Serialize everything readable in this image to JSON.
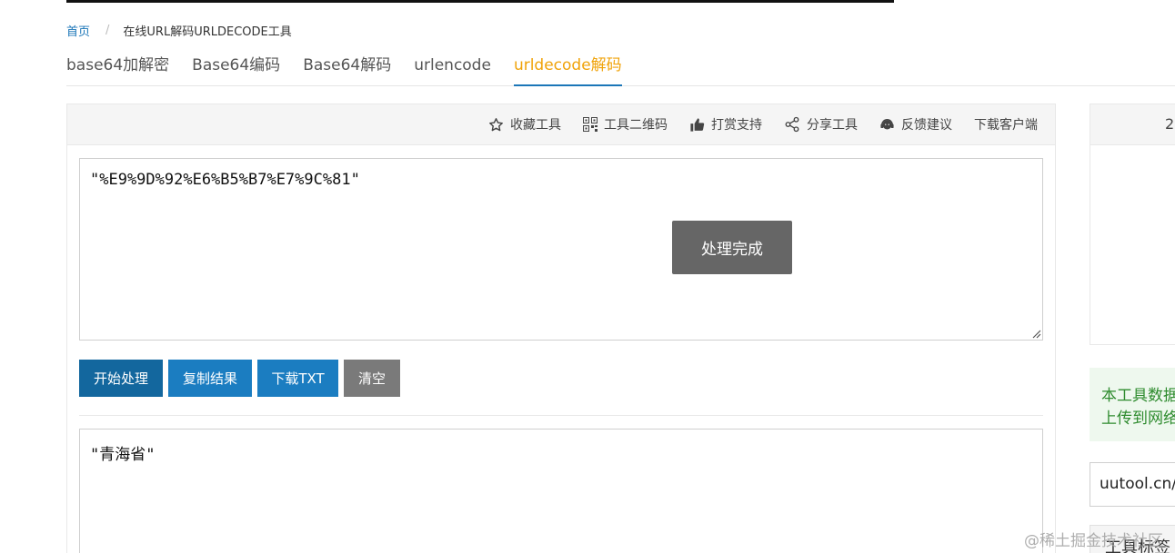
{
  "breadcrumb": {
    "home": "首页",
    "separator": "/",
    "current": "在线URL解码URLDECODE工具"
  },
  "tabs": [
    {
      "label": "base64加解密",
      "active": false
    },
    {
      "label": "Base64编码",
      "active": false
    },
    {
      "label": "Base64解码",
      "active": false
    },
    {
      "label": "urlencode",
      "active": false
    },
    {
      "label": "urldecode解码",
      "active": true
    }
  ],
  "toolbar": {
    "favorite": "收藏工具",
    "qrcode": "工具二维码",
    "reward": "打赏支持",
    "share": "分享工具",
    "feedback": "反馈建议",
    "download_client": "下载客户端"
  },
  "input": {
    "value": "\"%E9%9D%92%E6%B5%B7%E7%9C%81\""
  },
  "toast": {
    "message": "处理完成"
  },
  "buttons": {
    "start": "开始处理",
    "copy": "复制结果",
    "download": "下载TXT",
    "clear": "清空"
  },
  "output": {
    "value": "\"青海省\""
  },
  "side": {
    "header_partial": "2",
    "notice_line1": "本工具数据",
    "notice_line2": "上传到网络",
    "url_partial": "uutool.cn/u",
    "tags_label": "工具标签"
  },
  "watermark": "@稀土掘金技术社区",
  "colors": {
    "accent": "#1b76b8",
    "active_tab": "#f0a30a",
    "primary_button": "#1b7dc1",
    "clear_button": "#7a7a7a",
    "toast_bg": "#666666",
    "notice_text": "#2e8b2e"
  }
}
